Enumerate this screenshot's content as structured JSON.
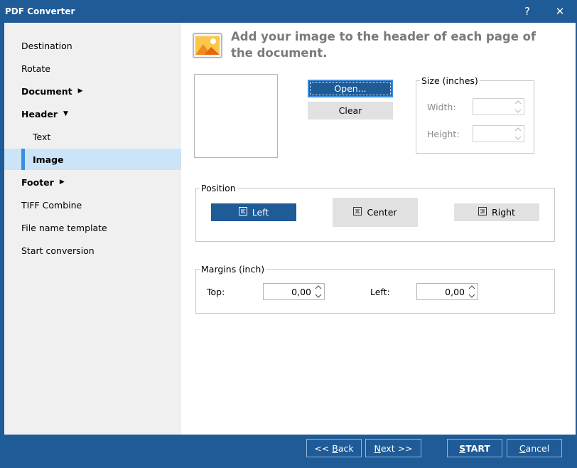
{
  "window": {
    "title": "PDF Converter",
    "help_label": "?",
    "close_label": "✕"
  },
  "sidebar": {
    "items": [
      {
        "label": "Destination"
      },
      {
        "label": "Rotate"
      },
      {
        "label": "Document"
      },
      {
        "label": "Header"
      },
      {
        "label": "Text"
      },
      {
        "label": "Image"
      },
      {
        "label": "Footer"
      },
      {
        "label": "TIFF Combine"
      },
      {
        "label": "File name template"
      },
      {
        "label": "Start conversion"
      }
    ],
    "active_item": "Image"
  },
  "main": {
    "heading": "Add your image to the header of each page of the document.",
    "open_label": "Open...",
    "clear_label": "Clear",
    "size": {
      "legend": "Size (inches)",
      "width_label": "Width:",
      "height_label": "Height:",
      "width_value": "",
      "height_value": ""
    },
    "position": {
      "legend": "Position",
      "left_label": "Left",
      "center_label": "Center",
      "right_label": "Right",
      "selected": "Left"
    },
    "margins": {
      "legend": "Margins (inch)",
      "top_label": "Top:",
      "top_value": "0,00",
      "left_label": "Left:",
      "left_value": "0,00"
    }
  },
  "footer": {
    "back_prefix": "<< ",
    "back_access": "B",
    "back_rest": "ack",
    "next_access": "N",
    "next_rest": "ext >>",
    "start_access": "S",
    "start_rest": "TART",
    "cancel_access": "C",
    "cancel_rest": "ancel"
  },
  "colors": {
    "accent": "#1e5b97",
    "active_nav_bg": "#cce4f7",
    "active_nav_bar": "#3a8fde",
    "sidebar_bg": "#f0f0f0"
  },
  "icons": {
    "header_image": "landscape-image-icon",
    "align_left": "align-left-icon",
    "align_center": "align-center-icon",
    "align_right": "align-right-icon"
  }
}
